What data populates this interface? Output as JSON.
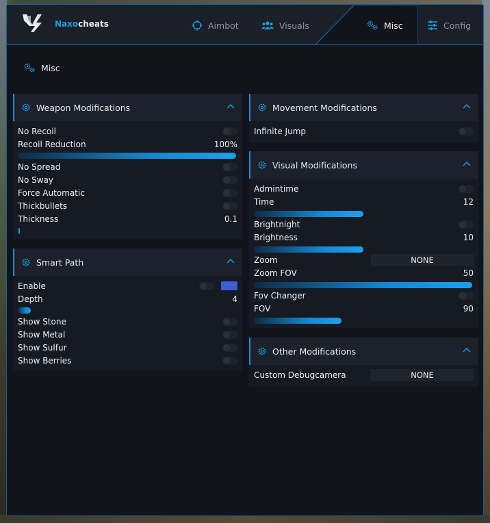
{
  "brand": {
    "accent": "Naxo",
    "rest": "cheats"
  },
  "tabs": [
    {
      "label": "Aimbot",
      "icon": "crosshair-icon",
      "active": false
    },
    {
      "label": "Visuals",
      "icon": "users-icon",
      "active": false
    },
    {
      "label": "Misc",
      "icon": "gears-icon",
      "active": true
    },
    {
      "label": "Config",
      "icon": "sliders-icon",
      "active": false
    }
  ],
  "page_title": "Misc",
  "colors": {
    "accent": "#1b8fd8",
    "window_bg": "#11141b",
    "card_bg": "#161a22",
    "swatch": "#3f5bd8"
  },
  "weapon": {
    "title": "Weapon Modifications",
    "no_recoil": "No Recoil",
    "recoil_reduction": "Recoil Reduction",
    "recoil_reduction_value": "100%",
    "recoil_reduction_fraction": 1.0,
    "no_spread": "No Spread",
    "no_sway": "No Sway",
    "force_automatic": "Force Automatic",
    "thickbullets": "Thickbullets",
    "thickness": "Thickness",
    "thickness_value": "0.1",
    "thickness_fraction": 0.01
  },
  "smart_path": {
    "title": "Smart Path",
    "enable": "Enable",
    "depth": "Depth",
    "depth_value": "4",
    "depth_fraction": 0.06,
    "show_stone": "Show Stone",
    "show_metal": "Show Metal",
    "show_sulfur": "Show Sulfur",
    "show_berries": "Show Berries"
  },
  "movement": {
    "title": "Movement Modifications",
    "infinite_jump": "Infinite Jump"
  },
  "visual": {
    "title": "Visual Modifications",
    "admintime": "Admintime",
    "time": "Time",
    "time_value": "12",
    "time_fraction": 0.5,
    "brightnight": "Brightnight",
    "brightness": "Brightness",
    "brightness_value": "10",
    "brightness_fraction": 0.5,
    "zoom": "Zoom",
    "zoom_select": "NONE",
    "zoom_fov": "Zoom FOV",
    "zoom_fov_value": "50",
    "zoom_fov_fraction": 1.0,
    "fov_changer": "Fov Changer",
    "fov": "FOV",
    "fov_value": "90",
    "fov_fraction": 0.4
  },
  "other": {
    "title": "Other Modifications",
    "custom_debugcamera": "Custom Debugcamera",
    "custom_debugcamera_select": "NONE"
  }
}
